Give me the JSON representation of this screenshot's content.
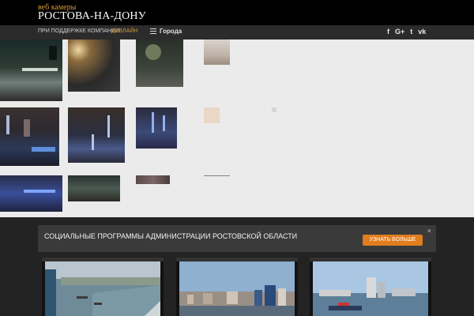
{
  "header": {
    "logo_small": "веб камеры",
    "logo_big": "РОСТОВА-НА-ДОНУ"
  },
  "nav": {
    "sponsor_text": "ПРИ ПОДДЕРЖКЕ КОМПАНИИ",
    "sponsor_name": "ДЕВЛАЙН",
    "cities_label": "Города",
    "social": {
      "facebook": "f",
      "googleplus": "G+",
      "twitter": "t",
      "vk": "vk"
    }
  },
  "banner": {
    "text": "СОЦИАЛЬНЫЕ ПРОГРАММЫ АДМИНИСТРАЦИИ РОСТОВСКОЙ ОБЛАСТИ",
    "button": "УЗНАТЬ БОЛЬШЕ",
    "close": "×"
  },
  "colors": {
    "accent": "#d69a3a",
    "button": "#e07d1f",
    "header_bg": "#000000",
    "nav_bg": "#2b2b2b",
    "gallery_bg": "#ebebeb"
  },
  "cameras": [
    {
      "name": "river-camera-1"
    },
    {
      "name": "city-camera-2"
    },
    {
      "name": "embankment-camera-3"
    }
  ]
}
